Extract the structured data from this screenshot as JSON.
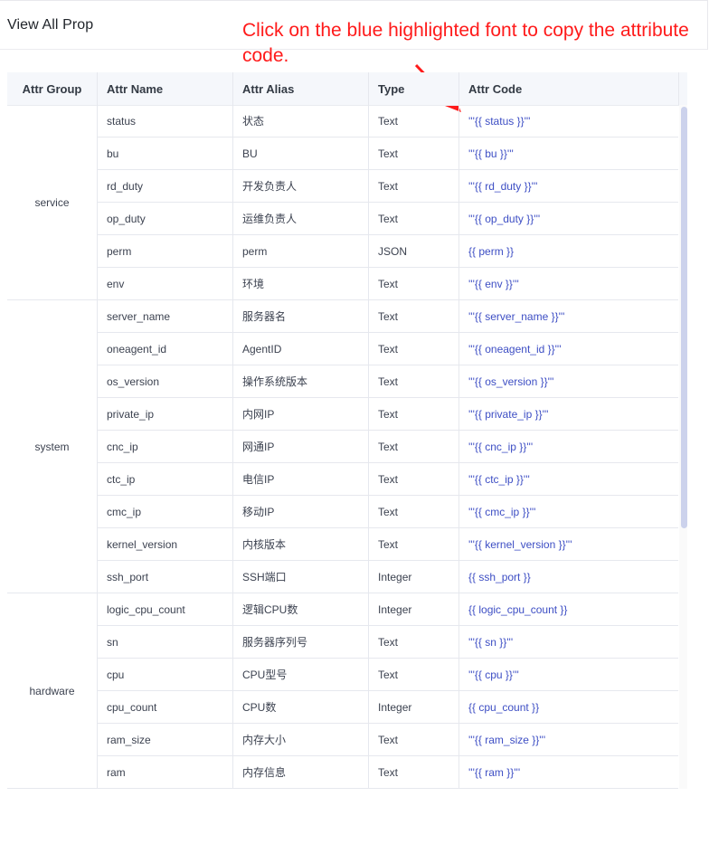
{
  "header": {
    "title": "View All Prop"
  },
  "annotation": {
    "text": "Click on the blue highlighted font to copy the attribute code."
  },
  "table": {
    "columns": [
      "Attr Group",
      "Attr Name",
      "Attr Alias",
      "Type",
      "Attr Code"
    ],
    "groups": [
      {
        "name": "service",
        "rows": [
          {
            "name": "status",
            "alias": "状态",
            "type": "Text",
            "code": "'''{{ status }}'''"
          },
          {
            "name": "bu",
            "alias": "BU",
            "type": "Text",
            "code": "'''{{ bu }}'''"
          },
          {
            "name": "rd_duty",
            "alias": "开发负责人",
            "type": "Text",
            "code": "'''{{ rd_duty }}'''"
          },
          {
            "name": "op_duty",
            "alias": "运维负责人",
            "type": "Text",
            "code": "'''{{ op_duty }}'''"
          },
          {
            "name": "perm",
            "alias": "perm",
            "type": "JSON",
            "code": "{{ perm }}"
          },
          {
            "name": "env",
            "alias": "环境",
            "type": "Text",
            "code": "'''{{ env }}'''"
          }
        ]
      },
      {
        "name": "system",
        "rows": [
          {
            "name": "server_name",
            "alias": "服务器名",
            "type": "Text",
            "code": "'''{{ server_name }}'''"
          },
          {
            "name": "oneagent_id",
            "alias": "AgentID",
            "type": "Text",
            "code": "'''{{ oneagent_id }}'''"
          },
          {
            "name": "os_version",
            "alias": "操作系统版本",
            "type": "Text",
            "code": "'''{{ os_version }}'''"
          },
          {
            "name": "private_ip",
            "alias": "内网IP",
            "type": "Text",
            "code": "'''{{ private_ip }}'''"
          },
          {
            "name": "cnc_ip",
            "alias": "网通IP",
            "type": "Text",
            "code": "'''{{ cnc_ip }}'''"
          },
          {
            "name": "ctc_ip",
            "alias": "电信IP",
            "type": "Text",
            "code": "'''{{ ctc_ip }}'''"
          },
          {
            "name": "cmc_ip",
            "alias": "移动IP",
            "type": "Text",
            "code": "'''{{ cmc_ip }}'''"
          },
          {
            "name": "kernel_version",
            "alias": "内核版本",
            "type": "Text",
            "code": "'''{{ kernel_version }}'''"
          },
          {
            "name": "ssh_port",
            "alias": "SSH端口",
            "type": "Integer",
            "code": "{{ ssh_port }}"
          }
        ]
      },
      {
        "name": "hardware",
        "rows": [
          {
            "name": "logic_cpu_count",
            "alias": "逻辑CPU数",
            "type": "Integer",
            "code": "{{ logic_cpu_count }}"
          },
          {
            "name": "sn",
            "alias": "服务器序列号",
            "type": "Text",
            "code": "'''{{ sn }}'''"
          },
          {
            "name": "cpu",
            "alias": "CPU型号",
            "type": "Text",
            "code": "'''{{ cpu }}'''"
          },
          {
            "name": "cpu_count",
            "alias": "CPU数",
            "type": "Integer",
            "code": "{{ cpu_count }}"
          },
          {
            "name": "ram_size",
            "alias": "内存大小",
            "type": "Text",
            "code": "'''{{ ram_size }}'''"
          },
          {
            "name": "ram",
            "alias": "内存信息",
            "type": "Text",
            "code": "'''{{ ram }}'''"
          }
        ]
      }
    ]
  },
  "colors": {
    "annotation": "#ff1a1a",
    "code_link": "#3d4ec4",
    "header_bg": "#f5f7fb",
    "scroll_thumb": "#ccd2ec"
  },
  "icons": {
    "annotation_arrow": "red-arrow-icon"
  }
}
